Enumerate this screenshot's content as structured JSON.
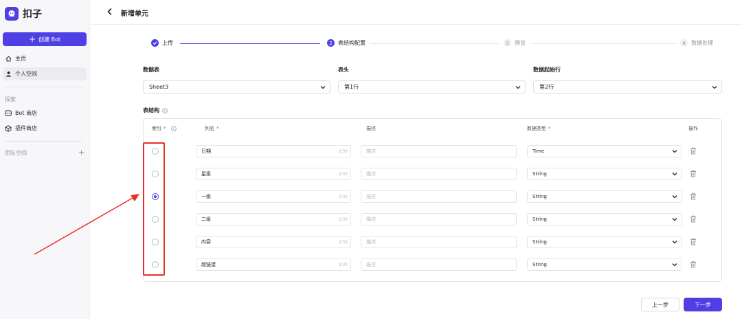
{
  "brand": {
    "name": "扣子"
  },
  "sidebar": {
    "create_label": "创建 Bot",
    "nav": [
      {
        "label": "主页",
        "icon": "home-icon"
      },
      {
        "label": "个人空间",
        "icon": "person-icon"
      }
    ],
    "explore_heading": "探索",
    "explore": [
      {
        "label": "Bot 商店",
        "icon": "bot-store-icon"
      },
      {
        "label": "插件商店",
        "icon": "plugin-store-icon"
      }
    ],
    "team_heading": "团队空间"
  },
  "header": {
    "title": "新增单元"
  },
  "steps": [
    {
      "num": "",
      "label": "上传",
      "state": "done"
    },
    {
      "num": "2",
      "label": "表结构配置",
      "state": "current"
    },
    {
      "num": "3",
      "label": "预览",
      "state": "todo"
    },
    {
      "num": "4",
      "label": "数据处理",
      "state": "todo"
    }
  ],
  "fields": {
    "sheet_label": "数据表",
    "sheet_value": "Sheet3",
    "header_label": "表头",
    "header_value": "第1行",
    "start_label": "数据起始行",
    "start_value": "第2行"
  },
  "structure": {
    "title": "表结构",
    "columns": {
      "index": "索引",
      "name": "列名",
      "desc": "描述",
      "type": "数据类型",
      "action": "操作"
    },
    "desc_placeholder": "描述",
    "rows": [
      {
        "name": "日期",
        "count": "2/30",
        "type": "Time",
        "indexed": false
      },
      {
        "name": "星级",
        "count": "2/30",
        "type": "String",
        "indexed": false
      },
      {
        "name": "一级",
        "count": "2/30",
        "type": "String",
        "indexed": true
      },
      {
        "name": "二级",
        "count": "2/30",
        "type": "String",
        "indexed": false
      },
      {
        "name": "内容",
        "count": "2/30",
        "type": "String",
        "indexed": false
      },
      {
        "name": "超链接",
        "count": "3/30",
        "type": "String",
        "indexed": false
      }
    ]
  },
  "footer": {
    "prev_label": "上一步",
    "next_label": "下一步"
  },
  "colors": {
    "accent": "#4e40e5",
    "annotation": "#e5302b"
  }
}
